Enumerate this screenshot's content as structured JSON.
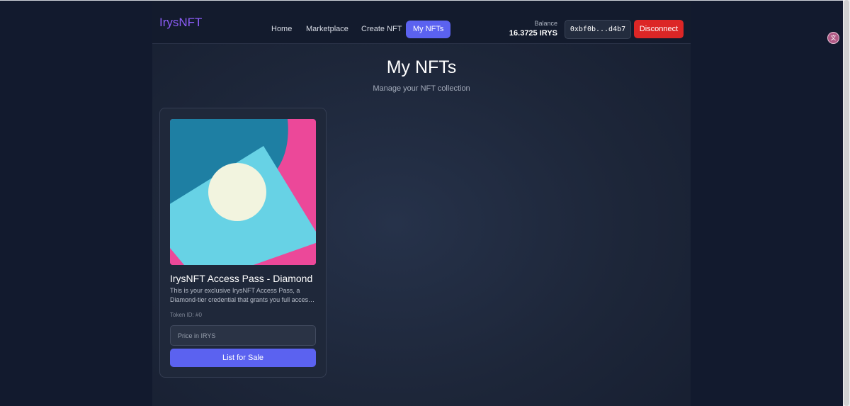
{
  "brand": {
    "name": "IrysNFT"
  },
  "nav": {
    "links": [
      {
        "label": "Home",
        "active": false
      },
      {
        "label": "Marketplace",
        "active": false
      },
      {
        "label": "Create NFT",
        "active": false
      },
      {
        "label": "My NFTs",
        "active": true
      }
    ]
  },
  "wallet": {
    "balance_label": "Balance",
    "balance_value": "16.3725 IRYS",
    "address": "0xbf0b...d4b7",
    "disconnect_label": "Disconnect"
  },
  "page": {
    "title": "My NFTs",
    "subtitle": "Manage your NFT collection"
  },
  "nfts": [
    {
      "name": "IrysNFT Access Pass - Diamond",
      "description_line1": "This is your exclusive IrysNFT Access Pass, a",
      "description_line2": "Diamond-tier credential that grants you full access ...",
      "token_id": "Token ID: #0",
      "price_placeholder": "Price in IRYS",
      "list_button": "List for Sale"
    }
  ],
  "colors": {
    "accent": "#5b62f0",
    "brand": "#8b5cf6",
    "danger": "#dc2626",
    "art_teal": "#1e7fa3",
    "art_pink": "#ec4899",
    "art_cyan": "#67d2e5",
    "art_cream": "#f2f4df"
  },
  "icons": {
    "extension": "translate-icon"
  }
}
